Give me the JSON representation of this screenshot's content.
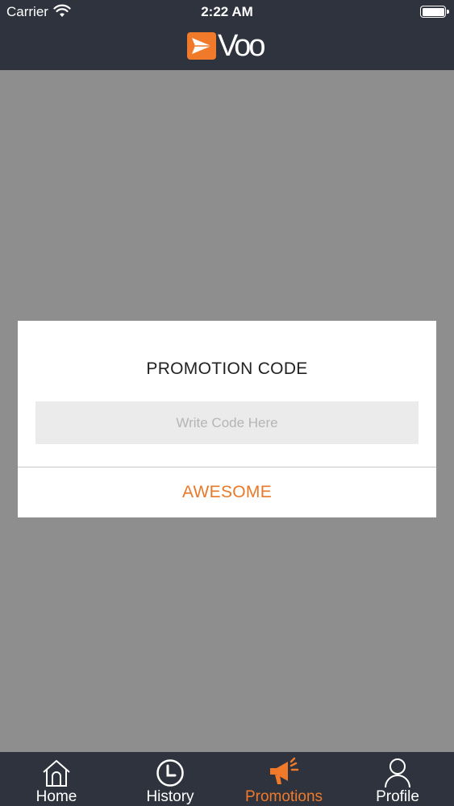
{
  "status_bar": {
    "carrier": "Carrier",
    "time": "2:22 AM"
  },
  "header": {
    "logo_text": "Voo",
    "brand_color": "#f07a2a",
    "bar_color": "#2f333d"
  },
  "dialog": {
    "title": "PROMOTION CODE",
    "input_placeholder": "Write Code Here",
    "input_value": "",
    "submit_label": "AWESOME",
    "submit_color": "#e8792a"
  },
  "tab_bar": {
    "active_tab": "Promotions",
    "tabs": [
      {
        "label": "Home",
        "icon": "home-icon"
      },
      {
        "label": "History",
        "icon": "clock-icon"
      },
      {
        "label": "Promotions",
        "icon": "megaphone-icon"
      },
      {
        "label": "Profile",
        "icon": "person-icon"
      }
    ]
  }
}
